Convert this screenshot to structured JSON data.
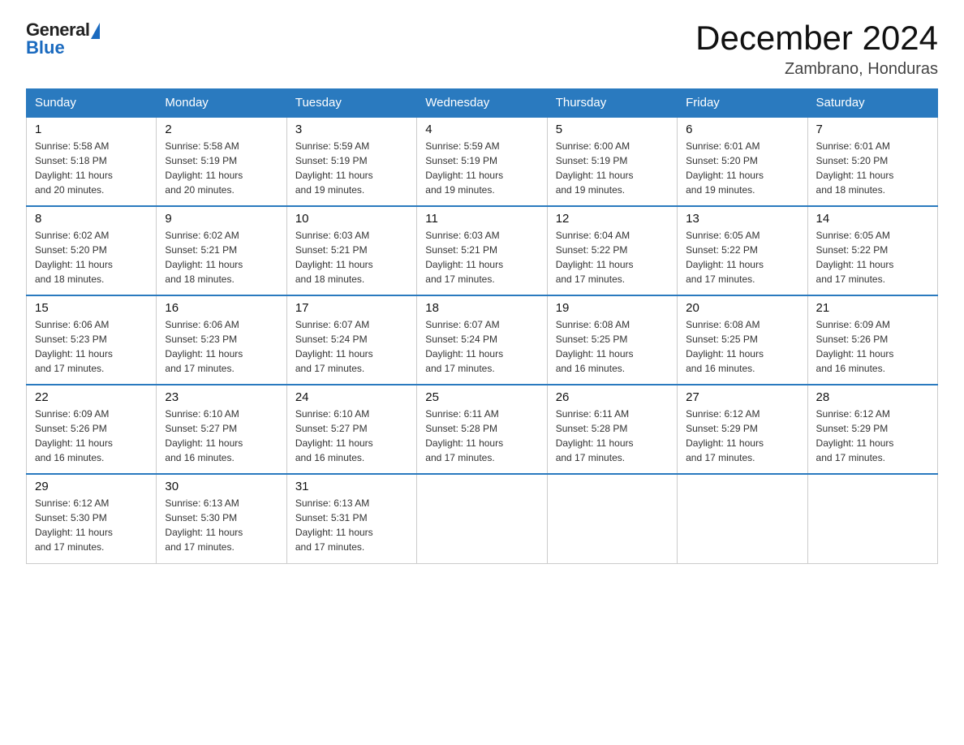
{
  "logo": {
    "general": "General",
    "blue": "Blue"
  },
  "header": {
    "title": "December 2024",
    "subtitle": "Zambrano, Honduras"
  },
  "days_of_week": [
    "Sunday",
    "Monday",
    "Tuesday",
    "Wednesday",
    "Thursday",
    "Friday",
    "Saturday"
  ],
  "weeks": [
    [
      {
        "day": "1",
        "sunrise": "5:58 AM",
        "sunset": "5:18 PM",
        "daylight": "11 hours and 20 minutes."
      },
      {
        "day": "2",
        "sunrise": "5:58 AM",
        "sunset": "5:19 PM",
        "daylight": "11 hours and 20 minutes."
      },
      {
        "day": "3",
        "sunrise": "5:59 AM",
        "sunset": "5:19 PM",
        "daylight": "11 hours and 19 minutes."
      },
      {
        "day": "4",
        "sunrise": "5:59 AM",
        "sunset": "5:19 PM",
        "daylight": "11 hours and 19 minutes."
      },
      {
        "day": "5",
        "sunrise": "6:00 AM",
        "sunset": "5:19 PM",
        "daylight": "11 hours and 19 minutes."
      },
      {
        "day": "6",
        "sunrise": "6:01 AM",
        "sunset": "5:20 PM",
        "daylight": "11 hours and 19 minutes."
      },
      {
        "day": "7",
        "sunrise": "6:01 AM",
        "sunset": "5:20 PM",
        "daylight": "11 hours and 18 minutes."
      }
    ],
    [
      {
        "day": "8",
        "sunrise": "6:02 AM",
        "sunset": "5:20 PM",
        "daylight": "11 hours and 18 minutes."
      },
      {
        "day": "9",
        "sunrise": "6:02 AM",
        "sunset": "5:21 PM",
        "daylight": "11 hours and 18 minutes."
      },
      {
        "day": "10",
        "sunrise": "6:03 AM",
        "sunset": "5:21 PM",
        "daylight": "11 hours and 18 minutes."
      },
      {
        "day": "11",
        "sunrise": "6:03 AM",
        "sunset": "5:21 PM",
        "daylight": "11 hours and 17 minutes."
      },
      {
        "day": "12",
        "sunrise": "6:04 AM",
        "sunset": "5:22 PM",
        "daylight": "11 hours and 17 minutes."
      },
      {
        "day": "13",
        "sunrise": "6:05 AM",
        "sunset": "5:22 PM",
        "daylight": "11 hours and 17 minutes."
      },
      {
        "day": "14",
        "sunrise": "6:05 AM",
        "sunset": "5:22 PM",
        "daylight": "11 hours and 17 minutes."
      }
    ],
    [
      {
        "day": "15",
        "sunrise": "6:06 AM",
        "sunset": "5:23 PM",
        "daylight": "11 hours and 17 minutes."
      },
      {
        "day": "16",
        "sunrise": "6:06 AM",
        "sunset": "5:23 PM",
        "daylight": "11 hours and 17 minutes."
      },
      {
        "day": "17",
        "sunrise": "6:07 AM",
        "sunset": "5:24 PM",
        "daylight": "11 hours and 17 minutes."
      },
      {
        "day": "18",
        "sunrise": "6:07 AM",
        "sunset": "5:24 PM",
        "daylight": "11 hours and 17 minutes."
      },
      {
        "day": "19",
        "sunrise": "6:08 AM",
        "sunset": "5:25 PM",
        "daylight": "11 hours and 16 minutes."
      },
      {
        "day": "20",
        "sunrise": "6:08 AM",
        "sunset": "5:25 PM",
        "daylight": "11 hours and 16 minutes."
      },
      {
        "day": "21",
        "sunrise": "6:09 AM",
        "sunset": "5:26 PM",
        "daylight": "11 hours and 16 minutes."
      }
    ],
    [
      {
        "day": "22",
        "sunrise": "6:09 AM",
        "sunset": "5:26 PM",
        "daylight": "11 hours and 16 minutes."
      },
      {
        "day": "23",
        "sunrise": "6:10 AM",
        "sunset": "5:27 PM",
        "daylight": "11 hours and 16 minutes."
      },
      {
        "day": "24",
        "sunrise": "6:10 AM",
        "sunset": "5:27 PM",
        "daylight": "11 hours and 16 minutes."
      },
      {
        "day": "25",
        "sunrise": "6:11 AM",
        "sunset": "5:28 PM",
        "daylight": "11 hours and 17 minutes."
      },
      {
        "day": "26",
        "sunrise": "6:11 AM",
        "sunset": "5:28 PM",
        "daylight": "11 hours and 17 minutes."
      },
      {
        "day": "27",
        "sunrise": "6:12 AM",
        "sunset": "5:29 PM",
        "daylight": "11 hours and 17 minutes."
      },
      {
        "day": "28",
        "sunrise": "6:12 AM",
        "sunset": "5:29 PM",
        "daylight": "11 hours and 17 minutes."
      }
    ],
    [
      {
        "day": "29",
        "sunrise": "6:12 AM",
        "sunset": "5:30 PM",
        "daylight": "11 hours and 17 minutes."
      },
      {
        "day": "30",
        "sunrise": "6:13 AM",
        "sunset": "5:30 PM",
        "daylight": "11 hours and 17 minutes."
      },
      {
        "day": "31",
        "sunrise": "6:13 AM",
        "sunset": "5:31 PM",
        "daylight": "11 hours and 17 minutes."
      },
      null,
      null,
      null,
      null
    ]
  ],
  "labels": {
    "sunrise": "Sunrise:",
    "sunset": "Sunset:",
    "daylight": "Daylight:"
  }
}
